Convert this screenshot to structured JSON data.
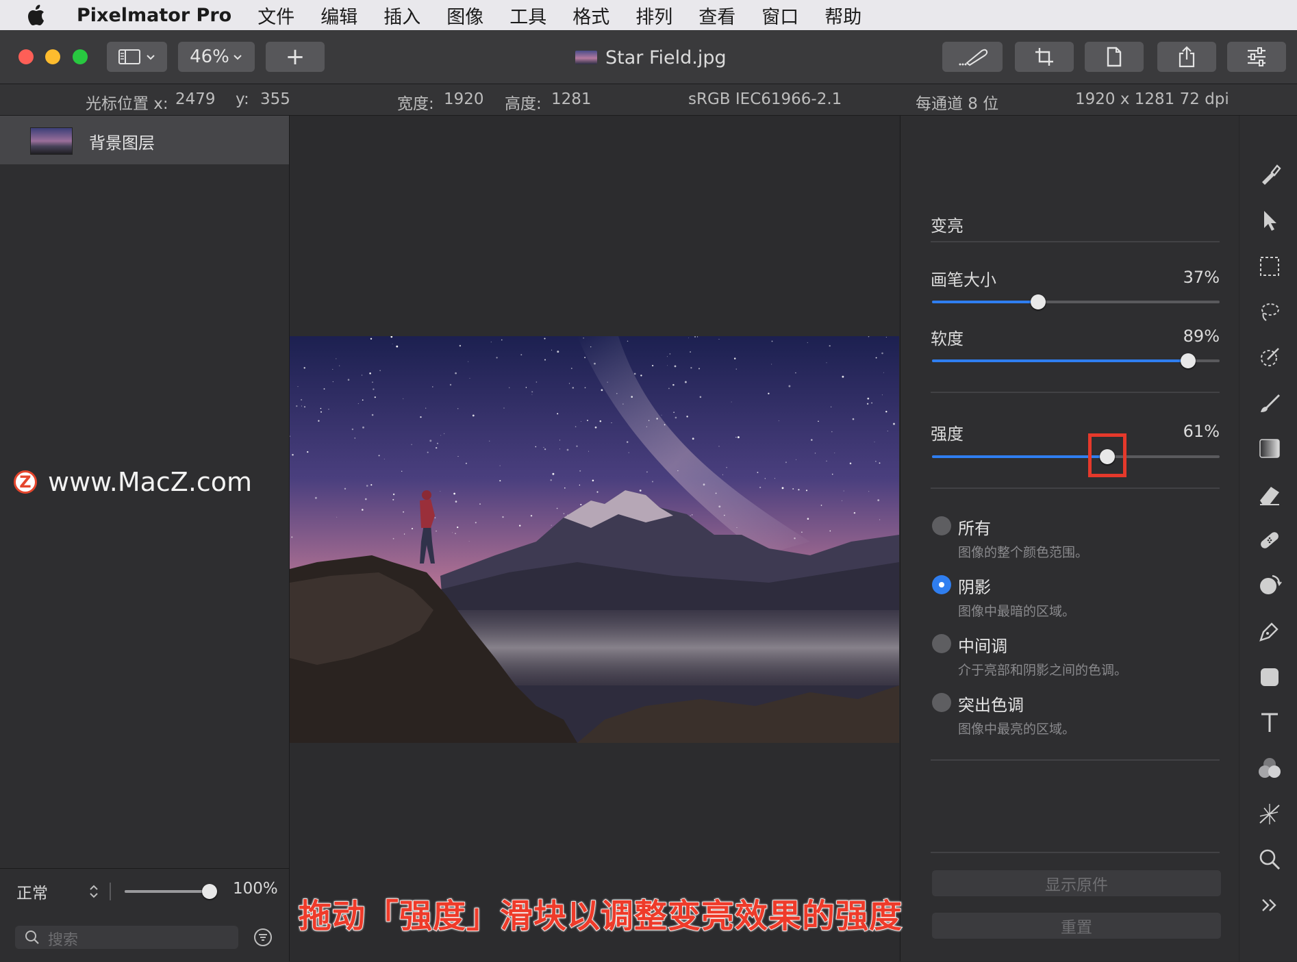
{
  "menubar": {
    "app_name": "Pixelmator Pro",
    "items": [
      "文件",
      "编辑",
      "插入",
      "图像",
      "工具",
      "格式",
      "排列",
      "查看",
      "窗口",
      "帮助"
    ]
  },
  "toolbar": {
    "zoom": "46%",
    "add_label": "+",
    "document_title": "Star Field.jpg"
  },
  "infobar": {
    "cursor_label": "光标位置 x:",
    "cursor_x": "2479",
    "cursor_y_label": "y:",
    "cursor_y": "355",
    "width_label": "宽度:",
    "width": "1920",
    "height_label": "高度:",
    "height": "1281",
    "color_profile": "sRGB IEC61966-2.1",
    "bit_depth": "每通道 8 位",
    "resolution": "1920 x 1281 72 dpi"
  },
  "layers": {
    "items": [
      {
        "name": "背景图层"
      }
    ],
    "blend_mode": "正常",
    "opacity": "100%",
    "opacity_fraction": 1.0,
    "search_placeholder": "搜索"
  },
  "watermark": {
    "badge": "Z",
    "text": "www.MacZ.com"
  },
  "panel": {
    "tool_name": "变亮",
    "brush_size": {
      "label": "画笔大小",
      "value": "37%",
      "fraction": 0.37
    },
    "softness": {
      "label": "软度",
      "value": "89%",
      "fraction": 0.89
    },
    "strength": {
      "label": "强度",
      "value": "61%",
      "fraction": 0.61
    },
    "ranges": [
      {
        "title": "所有",
        "desc": "图像的整个颜色范围。",
        "selected": false
      },
      {
        "title": "阴影",
        "desc": "图像中最暗的区域。",
        "selected": true
      },
      {
        "title": "中间调",
        "desc": "介于亮部和阴影之间的色调。",
        "selected": false
      },
      {
        "title": "突出色调",
        "desc": "图像中最亮的区域。",
        "selected": false
      }
    ],
    "show_original": "显示原件",
    "reset": "重置"
  },
  "tools": [
    "paint-brush-icon",
    "arrow-icon",
    "marquee-icon",
    "lasso-icon",
    "magic-wand-icon",
    "brush-icon",
    "gradient-icon",
    "eraser-icon",
    "bandage-icon",
    "lighten-icon",
    "pen-icon",
    "shape-icon",
    "type-icon",
    "color-adjust-icon",
    "effects-icon",
    "zoom-icon",
    "more-icon"
  ],
  "caption": "拖动「强度」滑块以调整变亮效果的强度",
  "colors": {
    "accent": "#2f7ef0",
    "highlight_box": "#e5392b",
    "caption": "#ee3b2a"
  }
}
